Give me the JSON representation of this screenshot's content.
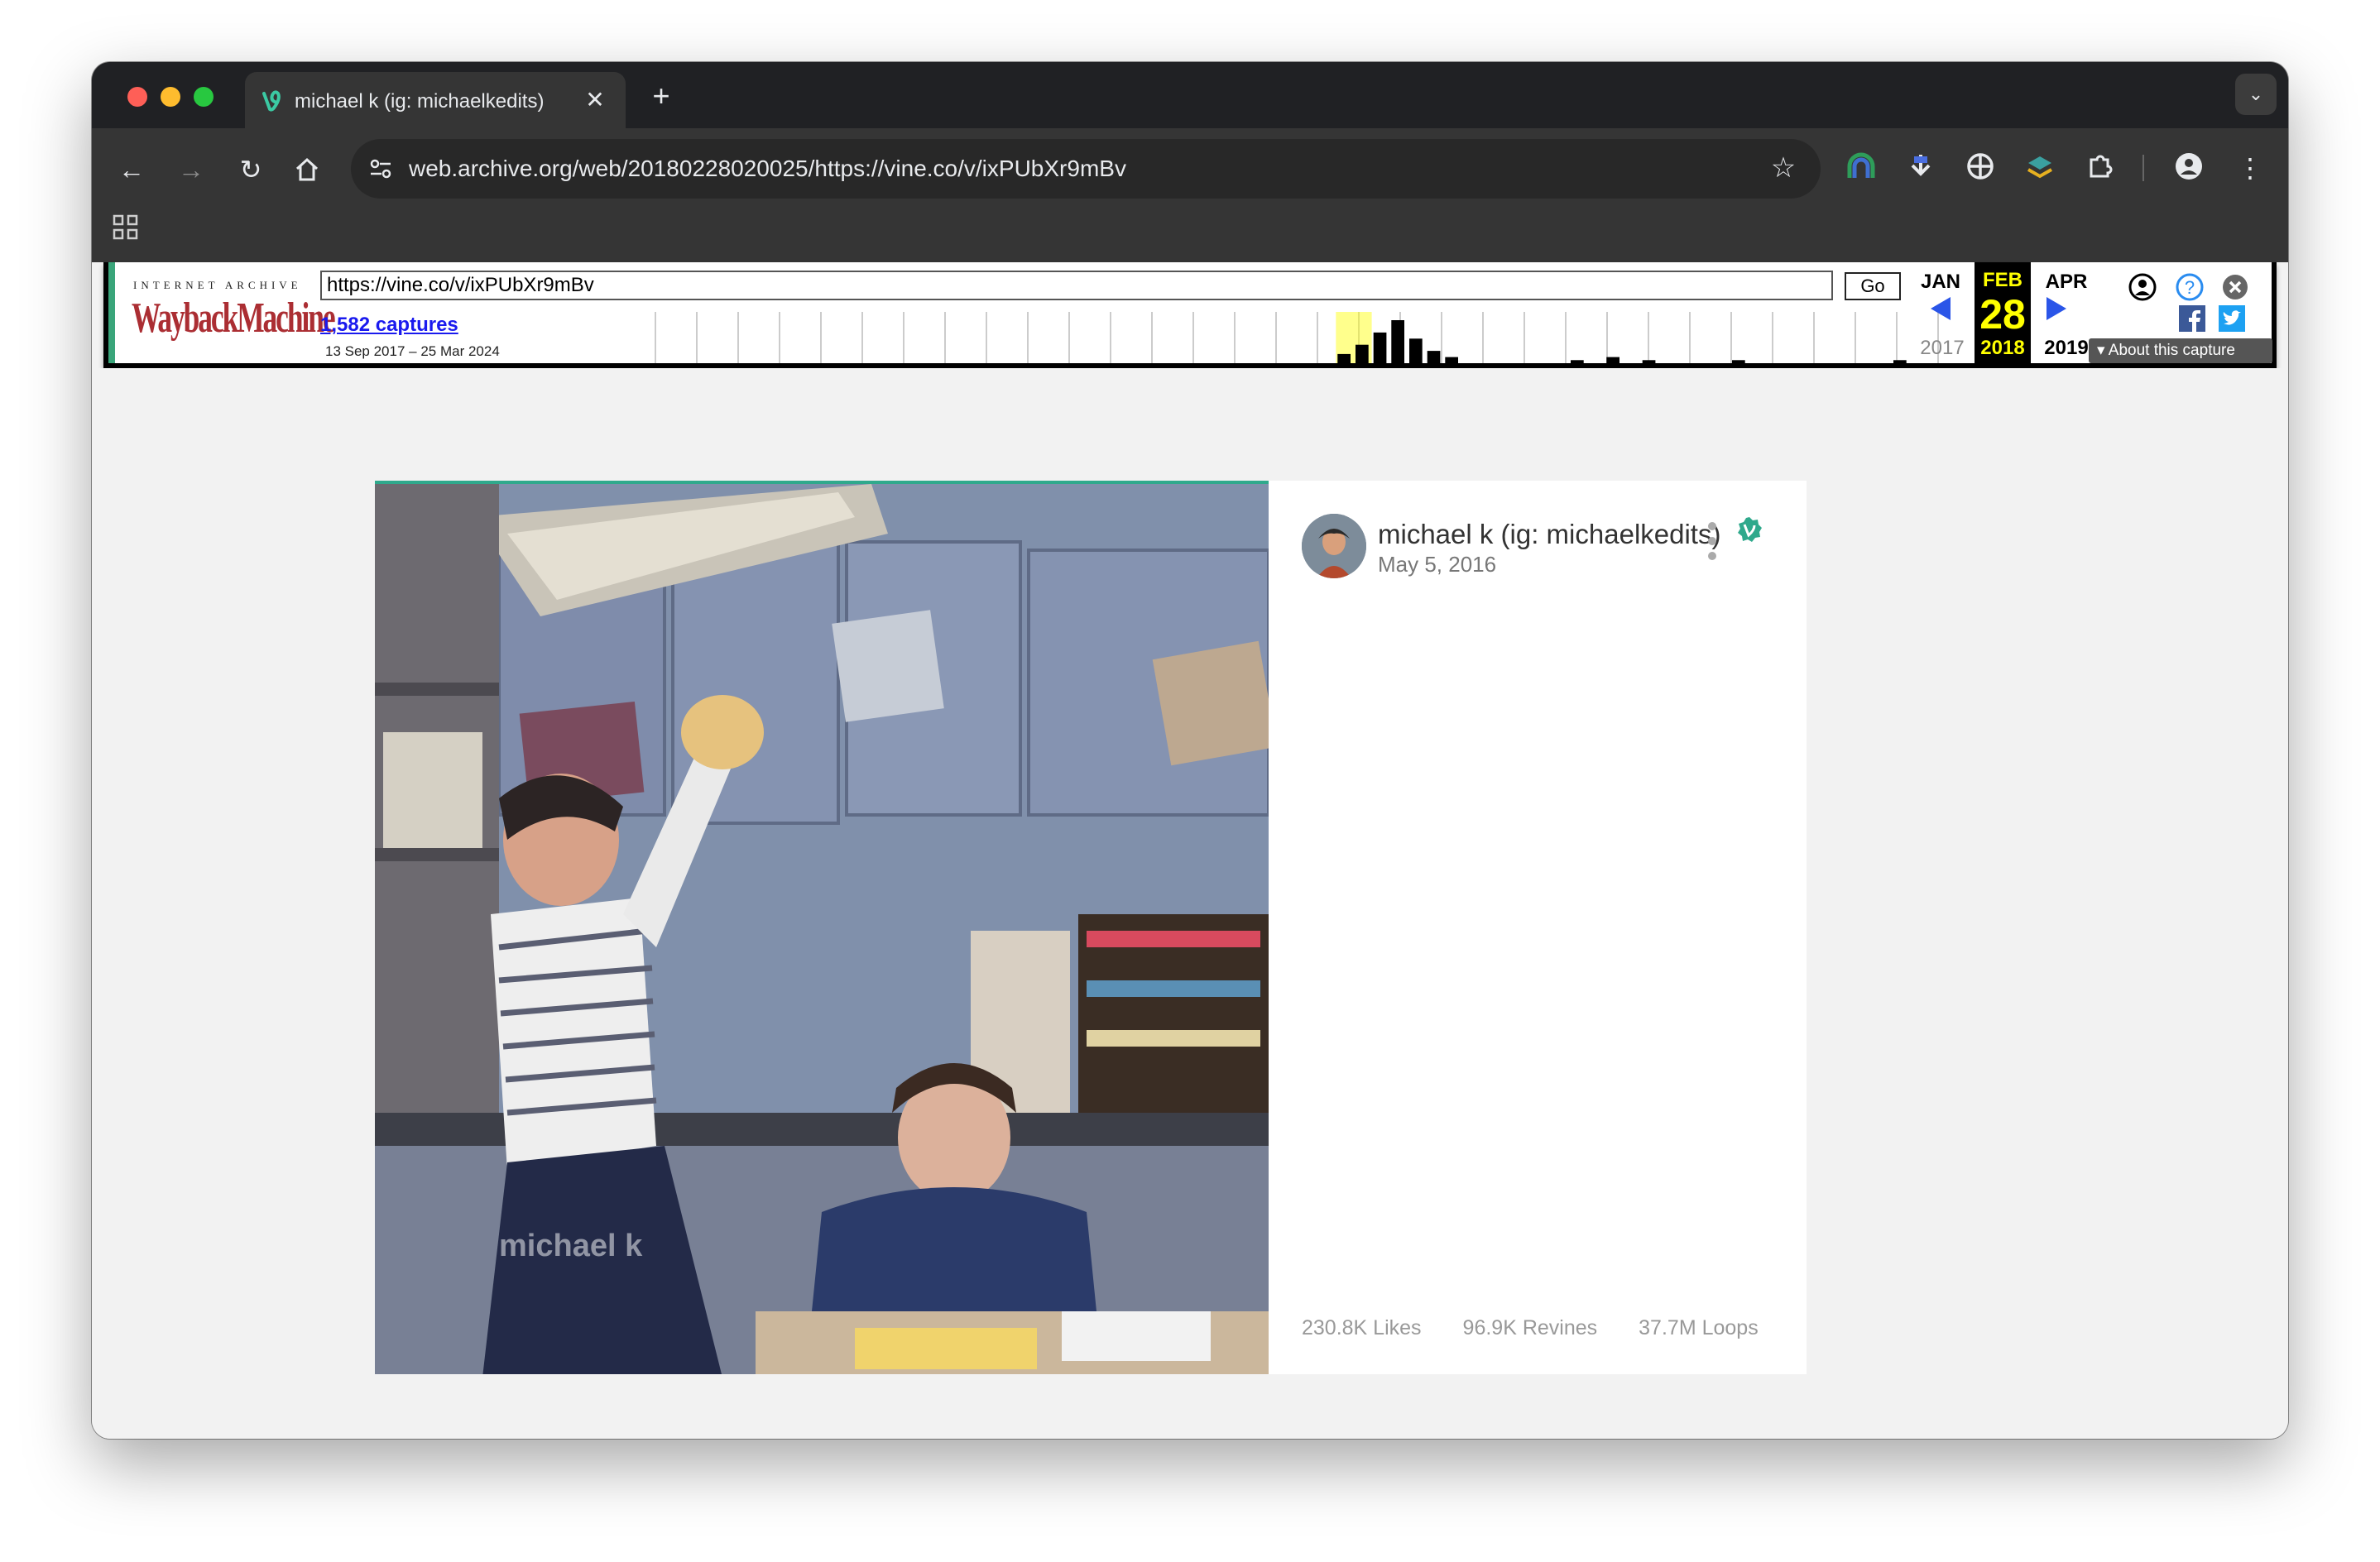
{
  "browser": {
    "tab_title": "michael k (ig: michaelkedits)",
    "url": "web.archive.org/web/20180228020025/https://vine.co/v/ixPUbXr9mBv"
  },
  "wayback": {
    "brand_top": "INTERNET ARCHIVE",
    "brand_logo": "WaybackMachine",
    "lookup_url": "https://vine.co/v/ixPUbXr9mBv",
    "go_label": "Go",
    "captures": "1,582 captures",
    "date_range": "13 Sep 2017 – 25 Mar 2024",
    "prev_month": "JAN",
    "current_month": "FEB",
    "next_month": "APR",
    "day": "28",
    "prev_year": "2017",
    "current_year": "2018",
    "next_year": "2019",
    "about_label": "About this capture",
    "capture_histogram": [
      0,
      0,
      0,
      0,
      0,
      0,
      0,
      0,
      0,
      0,
      0,
      0,
      0,
      0,
      0,
      0,
      0,
      0,
      0,
      0,
      0,
      0,
      0,
      0,
      0,
      0,
      0,
      0,
      0,
      0,
      0,
      0,
      0,
      0,
      0,
      0,
      0,
      0,
      3,
      6,
      10,
      14,
      8,
      4,
      2,
      0,
      0,
      0,
      0,
      0,
      0,
      1,
      0,
      2,
      0,
      1,
      0,
      0,
      0,
      0,
      1,
      0,
      0,
      0,
      0,
      0,
      0,
      0,
      0,
      1,
      0,
      0
    ]
  },
  "post": {
    "author_name": "michael k (ig: michaelkedits)",
    "date": "May 5, 2016",
    "watermark": "michael k",
    "likes": "230.8K Likes",
    "revines": "96.9K Revines",
    "loops": "37.7M Loops",
    "accent_color": "#2fa98c"
  }
}
